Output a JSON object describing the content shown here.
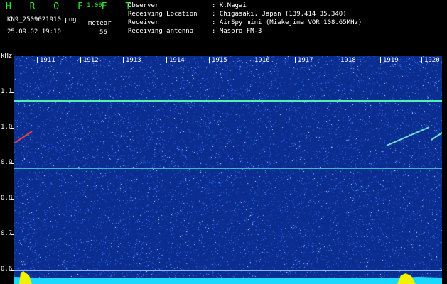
{
  "header": {
    "app_title": "H R O F F T",
    "version": "1.00f",
    "file_name": "KN9_2509021910.png",
    "meteor_label": "meteor",
    "meteor_count": "56",
    "datetime": "25.09.02 19:10"
  },
  "info": [
    {
      "key": "Observer",
      "value": ": K.Nagai"
    },
    {
      "key": "Receiving Location",
      "value": ": Chigasaki, Japan (139.414 35.340)"
    },
    {
      "key": "Receiver",
      "value": ": AirSpy mini (Miakejima VOR 108.65MHz)"
    },
    {
      "key": "Receiving antenna",
      "value": ": Maspro FM-3"
    }
  ],
  "plot": {
    "y_unit": "kHz",
    "y_ticks": [
      "1.1",
      "1.0",
      "0.9",
      "0.8",
      "0.7",
      "0.6"
    ],
    "x_ticks": [
      "1911",
      "1912",
      "1913",
      "1914",
      "1915",
      "1916",
      "1917",
      "1918",
      "1919",
      "1920"
    ],
    "colors": {
      "background": "#0a2d8f",
      "carrier": "#4ff0b0",
      "meteor": "#e84040"
    }
  }
}
